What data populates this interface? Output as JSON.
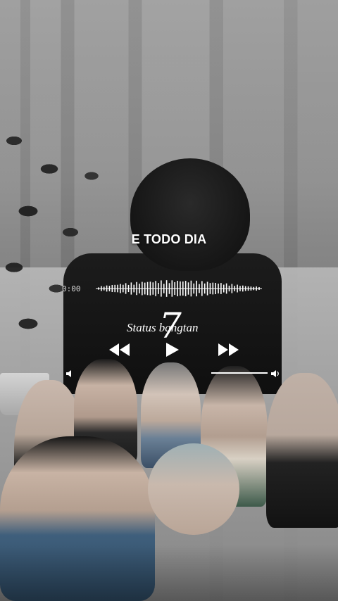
{
  "song": {
    "title": "E TODO DIA"
  },
  "player": {
    "current_time": "0:00",
    "progress": 0.0,
    "volume": 1.0
  },
  "brand": {
    "number": "7",
    "text": "Status bangtan"
  },
  "controls": {
    "rewind_icon": "rewind-icon",
    "play_icon": "play-icon",
    "forward_icon": "fast-forward-icon",
    "volume_down_icon": "volume-low-icon",
    "volume_up_icon": "volume-high-icon"
  },
  "colors": {
    "foreground": "#ffffff",
    "muted": "#d8d8d8"
  }
}
